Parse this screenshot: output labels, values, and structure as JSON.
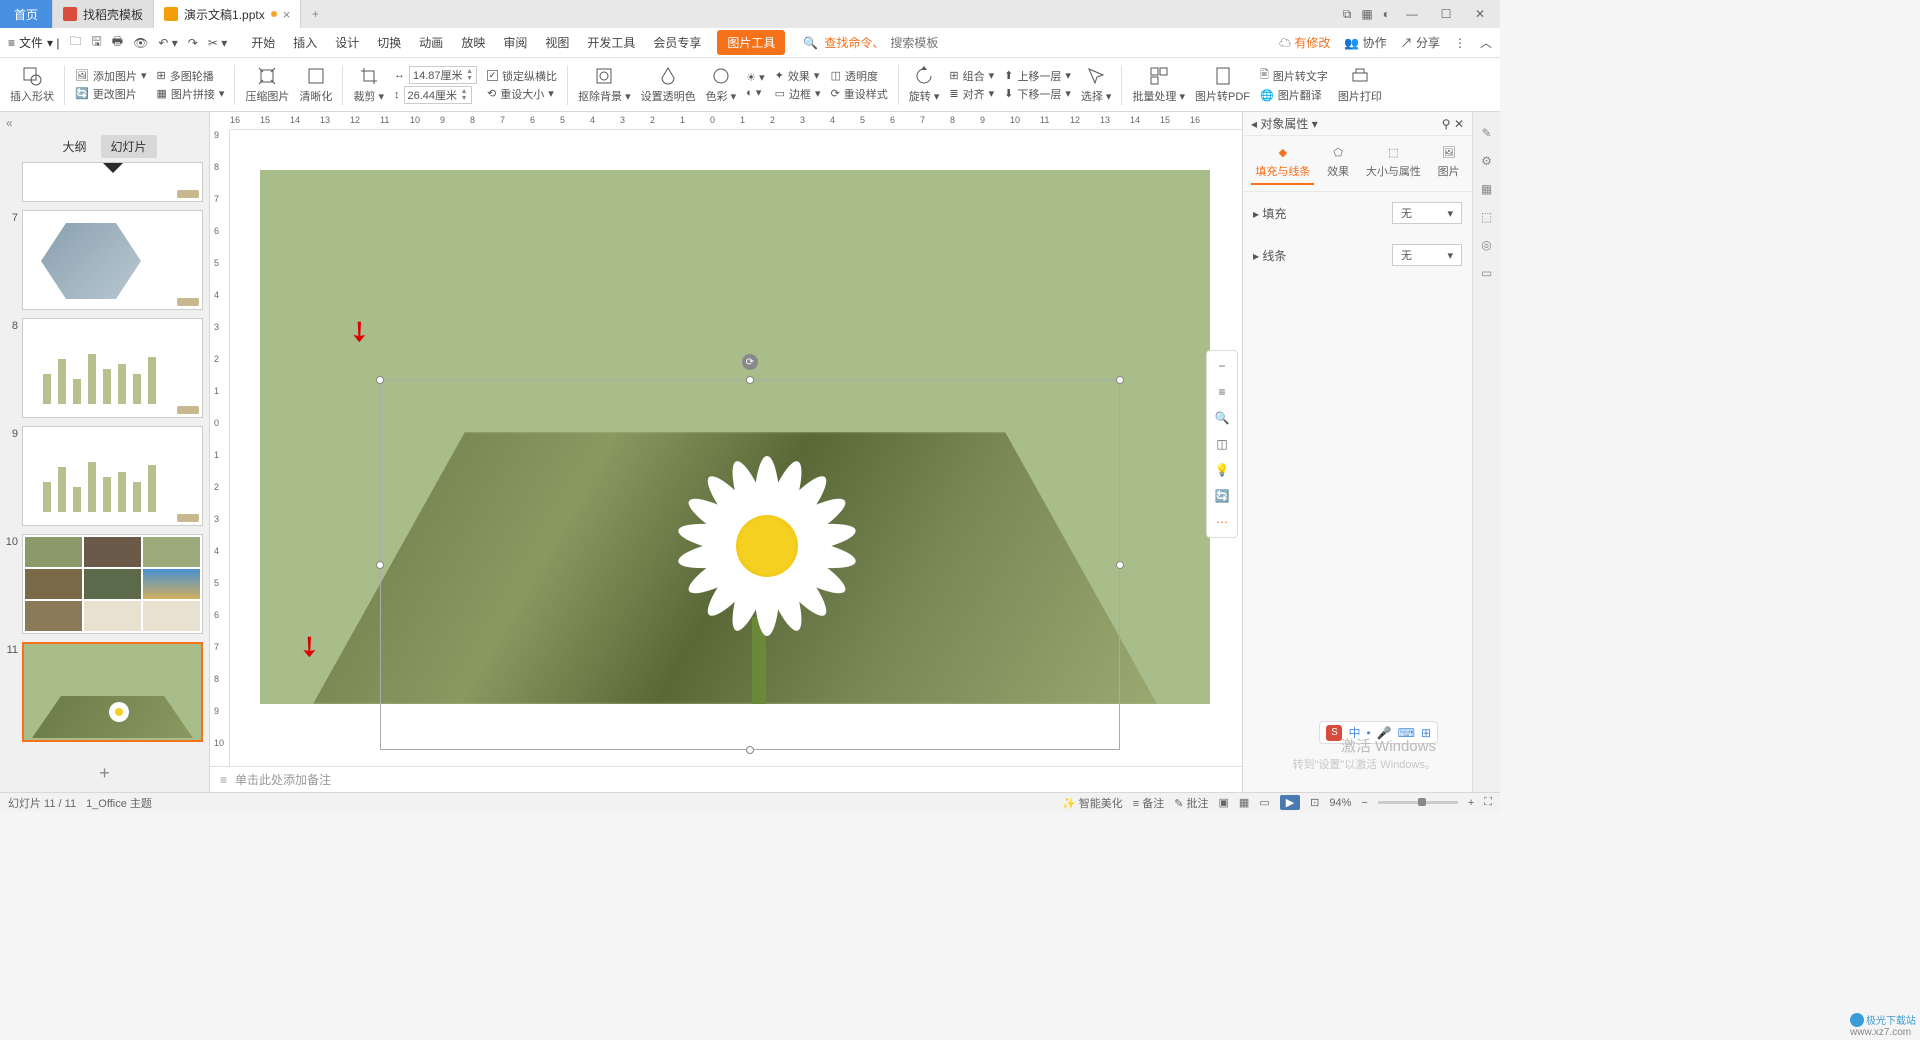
{
  "titlebar": {
    "home": "首页",
    "tab_template": "找稻壳模板",
    "tab_doc": "演示文稿1.pptx",
    "add": "+"
  },
  "menubar": {
    "file": "文件",
    "tabs": [
      "开始",
      "插入",
      "设计",
      "切换",
      "动画",
      "放映",
      "审阅",
      "视图",
      "开发工具",
      "会员专享"
    ],
    "context_tab": "图片工具",
    "search_prefix": "查找命令、",
    "search_placeholder": "搜索模板",
    "right_modified": "有修改",
    "right_coop": "协作",
    "right_share": "分享"
  },
  "ribbon": {
    "insert_shape": "插入形状",
    "add_image": "添加图片",
    "multi_rotate": "多图轮播",
    "change_image": "更改图片",
    "image_tile": "图片拼接",
    "compress": "压缩图片",
    "clarity": "清晰化",
    "crop": "裁剪",
    "width_val": "14.87厘米",
    "height_val": "26.44厘米",
    "lock_ratio": "锁定纵横比",
    "reset_size": "重设大小",
    "remove_bg": "抠除背景",
    "set_transparent": "设置透明色",
    "color": "色彩",
    "effects": "效果",
    "border": "边框",
    "transparency": "透明度",
    "reset_style": "重设样式",
    "rotate": "旋转",
    "group": "组合",
    "align": "对齐",
    "move_up": "上移一层",
    "move_down": "下移一层",
    "select": "选择",
    "batch": "批量处理",
    "to_pdf": "图片转PDF",
    "to_text": "图片转文字",
    "translate": "图片翻译",
    "print": "图片打印"
  },
  "left_panel": {
    "outline": "大纲",
    "slides": "幻灯片",
    "nums": [
      "",
      "7",
      "8",
      "9",
      "10",
      "11"
    ]
  },
  "props": {
    "title": "对象属性",
    "tab_fill": "填充与线条",
    "tab_effect": "效果",
    "tab_size": "大小与属性",
    "tab_image": "图片",
    "sec_fill": "填充",
    "sec_line": "线条",
    "none": "无"
  },
  "notes_placeholder": "单击此处添加备注",
  "status": {
    "slide": "幻灯片 11 / 11",
    "theme": "1_Office 主题",
    "beautify": "智能美化",
    "notes": "备注",
    "annotate": "批注",
    "zoom": "94%"
  },
  "activate": {
    "t1": "激活 Windows",
    "t2": "转到\"设置\"以激活 Windows。"
  },
  "brand": "极光下载站",
  "brand_url": "www.xz7.com",
  "ime": "中"
}
